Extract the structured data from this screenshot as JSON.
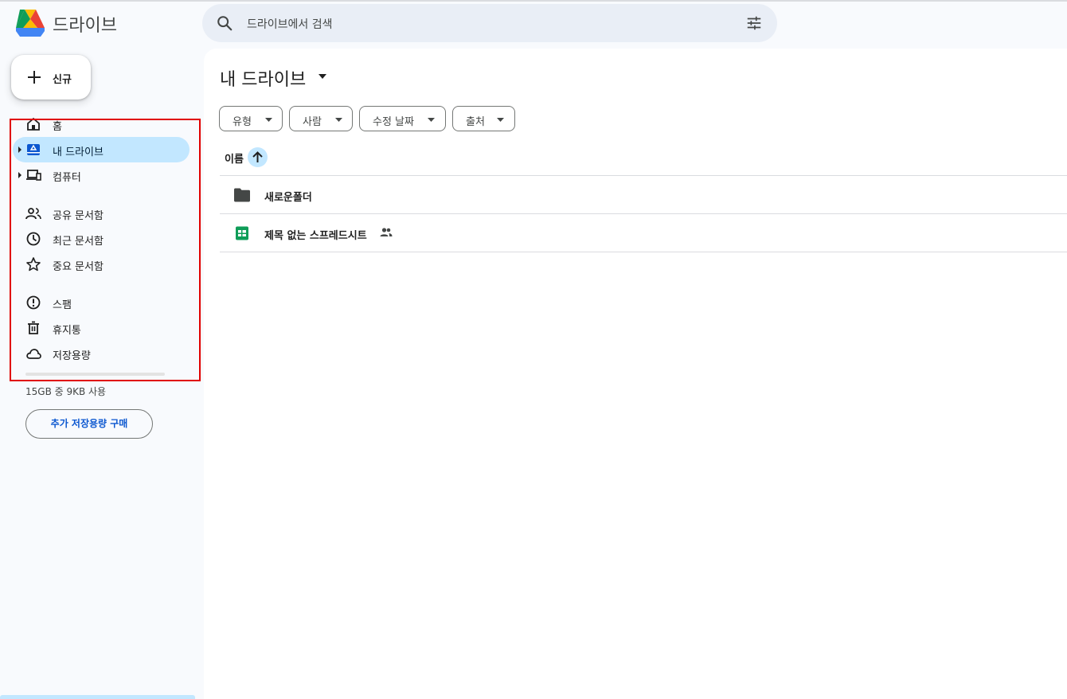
{
  "header": {
    "brand": "드라이브",
    "search_placeholder": "드라이브에서 검색"
  },
  "sidebar": {
    "new_label": "신규",
    "items": [
      {
        "label": "홈",
        "icon": "home-icon"
      },
      {
        "label": "내 드라이브",
        "icon": "my-drive-icon",
        "active": true
      },
      {
        "label": "컴퓨터",
        "icon": "computer-icon"
      },
      {
        "label": "공유 문서함",
        "icon": "shared-people-icon"
      },
      {
        "label": "최근 문서함",
        "icon": "clock-icon"
      },
      {
        "label": "중요 문서함",
        "icon": "star-icon"
      },
      {
        "label": "스팸",
        "icon": "spam-icon"
      },
      {
        "label": "휴지통",
        "icon": "trash-icon"
      },
      {
        "label": "저장용량",
        "icon": "cloud-icon"
      }
    ],
    "storage_text": "15GB 중 9KB 사용",
    "storage_used_fraction": 0.0,
    "buy_storage_label": "추가 저장용량 구매"
  },
  "main": {
    "title": "내 드라이브",
    "filters": [
      "유형",
      "사람",
      "수정 날짜",
      "출처"
    ],
    "sort_column": "이름",
    "files": [
      {
        "name": "새로운폴더",
        "type": "folder-icon"
      },
      {
        "name": "제목 없는 스프레드시트",
        "type": "sheets-icon",
        "shared": true
      }
    ]
  },
  "colors": {
    "accent": "#0b57d0",
    "active_nav": "#c2e7ff",
    "highlight_box": "#e00000"
  }
}
